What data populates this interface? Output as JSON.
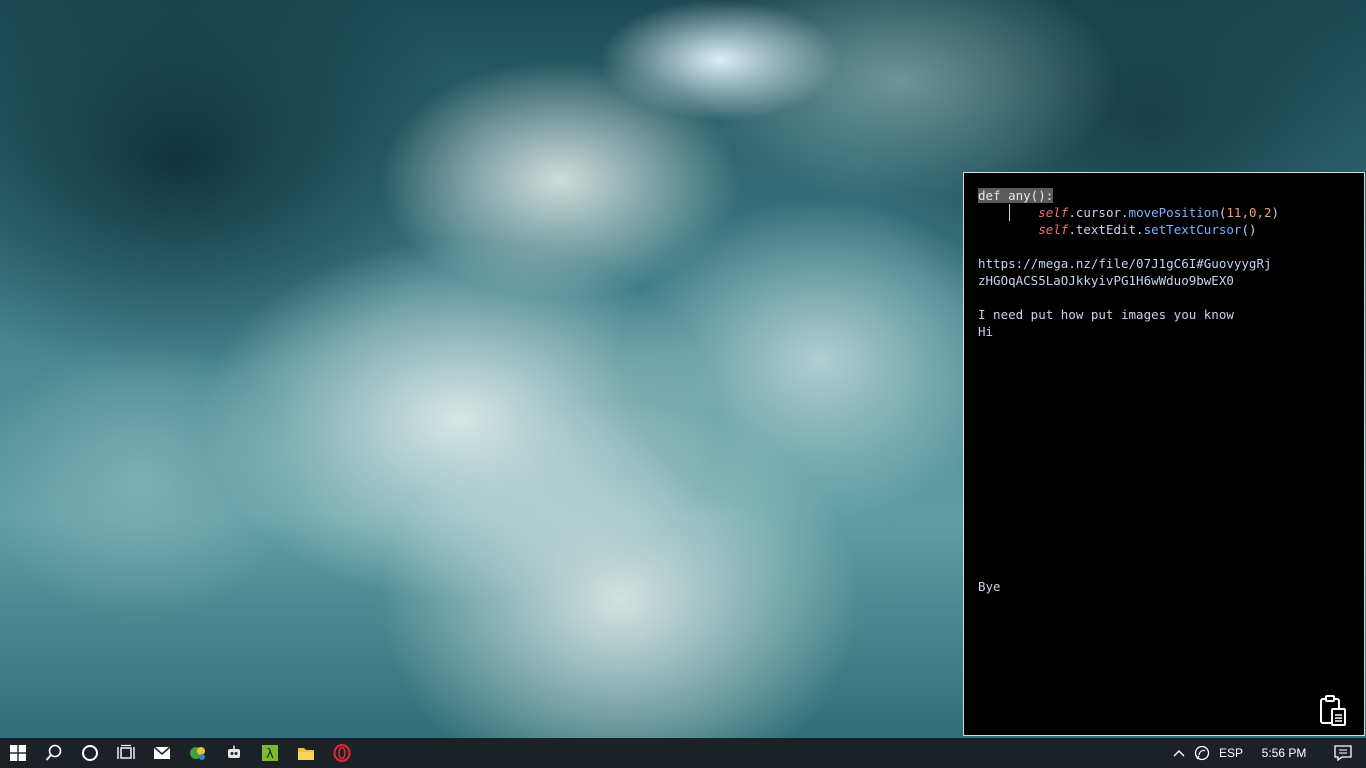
{
  "terminal": {
    "lines": [
      {
        "segments": [
          {
            "text": "def any():",
            "style": "sel"
          }
        ]
      },
      {
        "segments": [
          {
            "text": "        ",
            "style": "plain"
          },
          {
            "text": "self",
            "style": "kw"
          },
          {
            "text": ".cursor.",
            "style": "plain"
          },
          {
            "text": "movePosition",
            "style": "fn"
          },
          {
            "text": "(",
            "style": "plain"
          },
          {
            "text": "11,0,2",
            "style": "num"
          },
          {
            "text": ")",
            "style": "plain"
          }
        ],
        "caret": true
      },
      {
        "segments": [
          {
            "text": "        ",
            "style": "plain"
          },
          {
            "text": "self",
            "style": "kw"
          },
          {
            "text": ".textEdit.",
            "style": "plain"
          },
          {
            "text": "setTextCursor",
            "style": "fn"
          },
          {
            "text": "()",
            "style": "plain"
          }
        ]
      },
      {
        "segments": []
      },
      {
        "segments": [
          {
            "text": "https://mega.nz/file/07J1gC6I#GuovyygRj",
            "style": "plain"
          }
        ]
      },
      {
        "segments": [
          {
            "text": "zHGOqACS5LaOJkkyivPG1H6wWduo9bwEX0",
            "style": "plain"
          }
        ]
      },
      {
        "segments": []
      },
      {
        "segments": [
          {
            "text": "I need put how put images you know",
            "style": "plain"
          }
        ]
      },
      {
        "segments": [
          {
            "text": "Hi",
            "style": "plain"
          }
        ]
      },
      {
        "segments": []
      },
      {
        "segments": []
      },
      {
        "segments": []
      },
      {
        "segments": []
      },
      {
        "segments": []
      },
      {
        "segments": []
      },
      {
        "segments": []
      },
      {
        "segments": []
      },
      {
        "segments": []
      },
      {
        "segments": []
      },
      {
        "segments": []
      },
      {
        "segments": []
      },
      {
        "segments": []
      },
      {
        "segments": []
      },
      {
        "segments": [
          {
            "text": "Bye",
            "style": "plain"
          }
        ]
      }
    ]
  },
  "taskbar": {
    "icons": [
      "windows-start-icon",
      "search-icon",
      "cortana-icon",
      "task-view-icon",
      "mail-icon",
      "app-green-icon",
      "app-bot-icon",
      "lambda-app-icon",
      "file-explorer-icon",
      "opera-icon"
    ],
    "tray": {
      "language": "ESP",
      "time": "5:56 PM"
    }
  },
  "colors": {
    "taskbar_bg": "#1c2128",
    "terminal_bg": "#000000",
    "text": "#b9c6e8",
    "keyword": "#f07178",
    "function": "#7fb0ff",
    "number": "#f2a46a"
  }
}
